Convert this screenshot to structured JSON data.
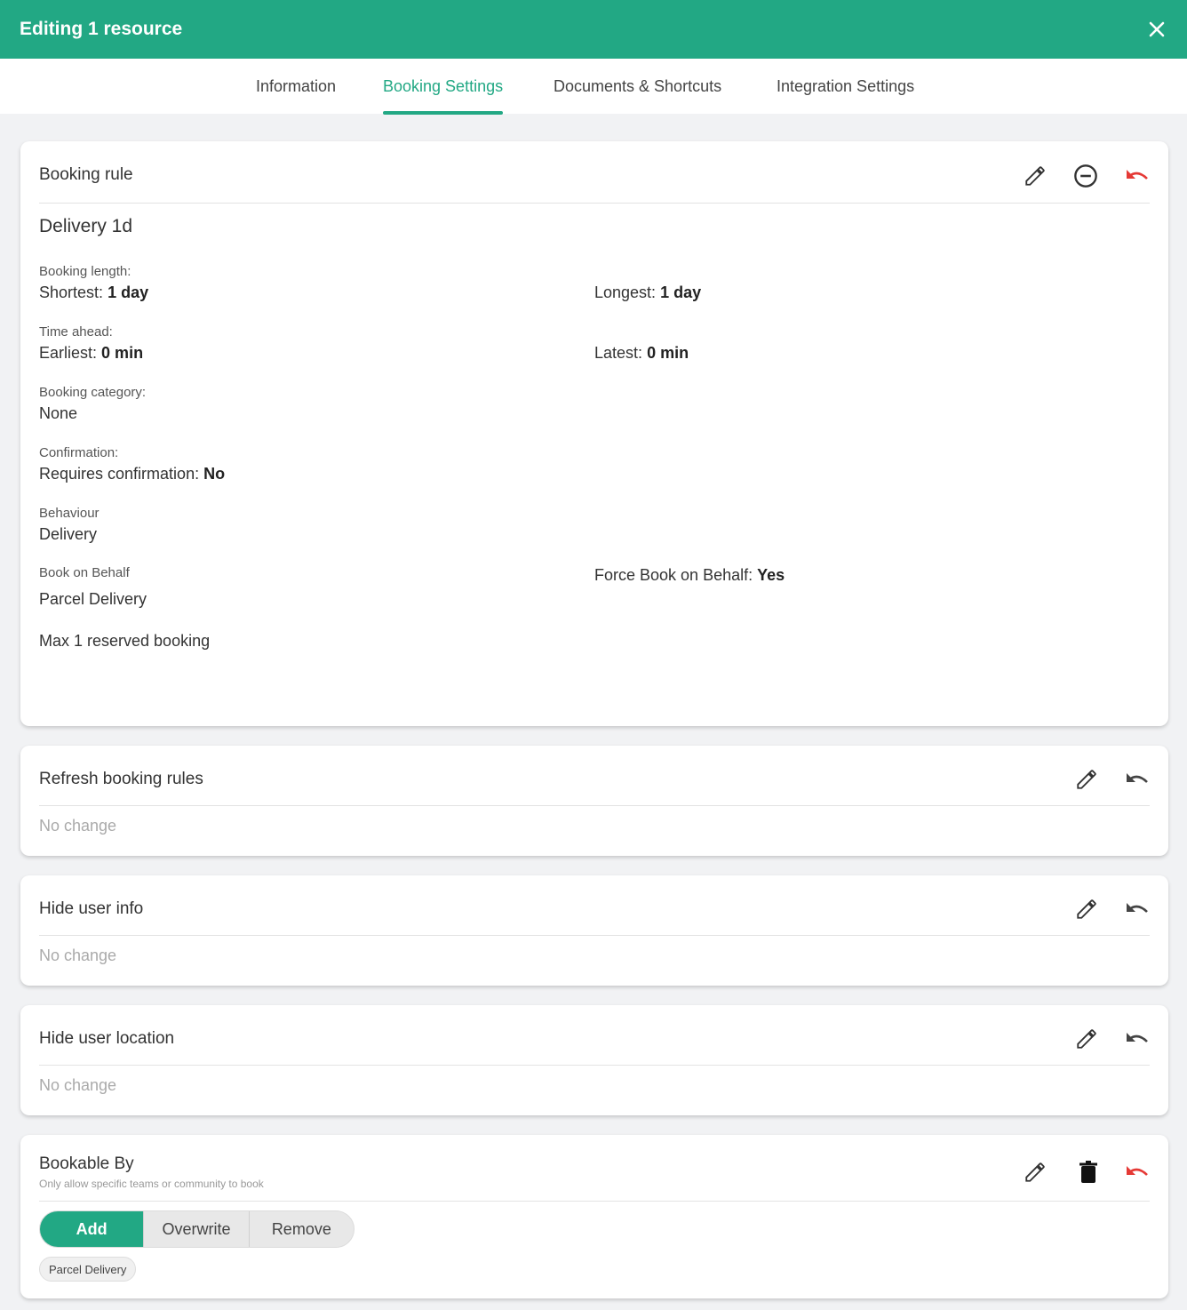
{
  "header": {
    "title": "Editing 1 resource",
    "close_icon": "close-icon"
  },
  "tabs": [
    {
      "label": "Information"
    },
    {
      "label": "Booking Settings",
      "active": true
    },
    {
      "label": "Documents & Shortcuts"
    },
    {
      "label": "Integration Settings"
    }
  ],
  "colors": {
    "accent": "#22a884",
    "undo_active": "#e53935"
  },
  "booking_rule": {
    "title": "Booking rule",
    "rule_name": "Delivery 1d",
    "booking_length_label": "Booking length:",
    "shortest_label": "Shortest:",
    "shortest_value": "1 day",
    "longest_label": "Longest:",
    "longest_value": "1 day",
    "time_ahead_label": "Time ahead:",
    "earliest_label": "Earliest:",
    "earliest_value": "0 min",
    "latest_label": "Latest:",
    "latest_value": "0 min",
    "category_label": "Booking category:",
    "category_value": "None",
    "confirmation_label": "Confirmation:",
    "requires_confirmation_label": "Requires confirmation:",
    "requires_confirmation_value": "No",
    "behaviour_label": "Behaviour",
    "behaviour_value": "Delivery",
    "book_on_behalf_label": "Book on Behalf",
    "book_on_behalf_value": "Parcel Delivery",
    "force_book_label": "Force Book on Behalf:",
    "force_book_value": "Yes",
    "max_reserved": "Max 1 reserved booking"
  },
  "refresh_rules": {
    "title": "Refresh booking rules",
    "status": "No change"
  },
  "hide_user_info": {
    "title": "Hide user info",
    "status": "No change"
  },
  "hide_user_location": {
    "title": "Hide user location",
    "status": "No change"
  },
  "bookable_by": {
    "title": "Bookable By",
    "subtitle": "Only allow specific teams or community to book",
    "modes": [
      "Add",
      "Overwrite",
      "Remove"
    ],
    "selected_mode": "Add",
    "chip": "Parcel Delivery"
  }
}
